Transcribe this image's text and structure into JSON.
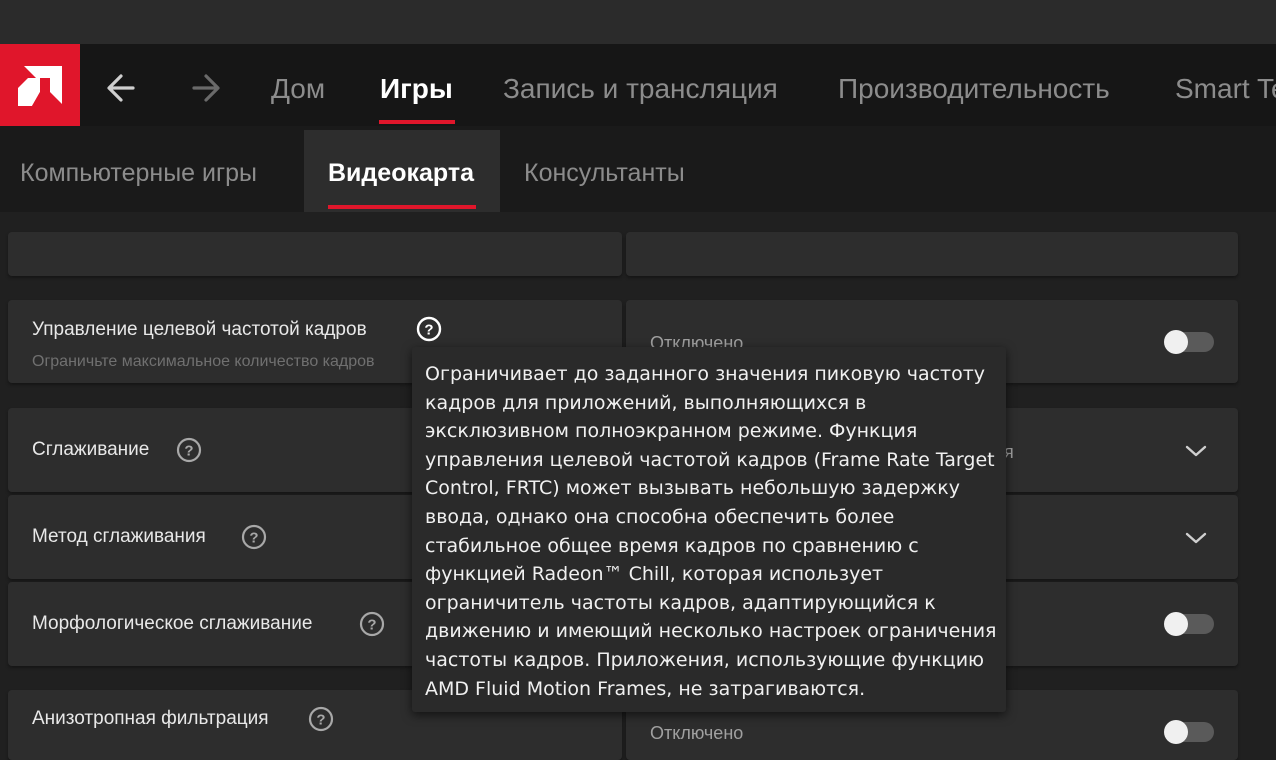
{
  "app": {
    "logo_icon": "amd-logo-icon",
    "accent_color": "#e0162b"
  },
  "nav": {
    "back_icon": "arrow-left-icon",
    "forward_icon": "arrow-right-icon",
    "tabs": [
      {
        "label": "Дом",
        "active": false
      },
      {
        "label": "Игры",
        "active": true
      },
      {
        "label": "Запись и трансляция",
        "active": false
      },
      {
        "label": "Производительность",
        "active": false
      },
      {
        "label": "Smart Te",
        "active": false
      }
    ]
  },
  "subnav": {
    "tabs": [
      {
        "label": "Компьютерные игры",
        "active": false
      },
      {
        "label": "Видеокарта",
        "active": true
      },
      {
        "label": "Консультанты",
        "active": false
      }
    ]
  },
  "settings": {
    "frtc": {
      "title": "Управление целевой частотой кадров",
      "subtitle": "Ограничьте максимальное количество кадров",
      "value": "Отключено",
      "enabled": false
    },
    "antialiasing": {
      "title": "Сглаживание",
      "value_partial": "я"
    },
    "aa_method": {
      "title": "Метод сглаживания"
    },
    "morphological_aa": {
      "title": "Морфологическое сглаживание",
      "enabled": false
    },
    "anisotropic": {
      "title": "Анизотропная фильтрация",
      "value": "Отключено",
      "enabled": false
    }
  },
  "tooltip": {
    "text": "Ограничивает до заданного значения пиковую частоту кадров для приложений, выполняющихся в эксклюзивном полноэкранном режиме. Функция управления целевой частотой кадров (Frame Rate Target Control, FRTC) может вызывать небольшую задержку ввода, однако она способна обеспечить более стабильное общее время кадров по сравнению с функцией Radeon™ Chill, которая использует ограничитель частоты кадров, адаптирующийся к движению и имеющий несколько настроек ограничения частоты кадров. Приложения, использующие функцию AMD Fluid Motion Frames, не затрагиваются."
  }
}
